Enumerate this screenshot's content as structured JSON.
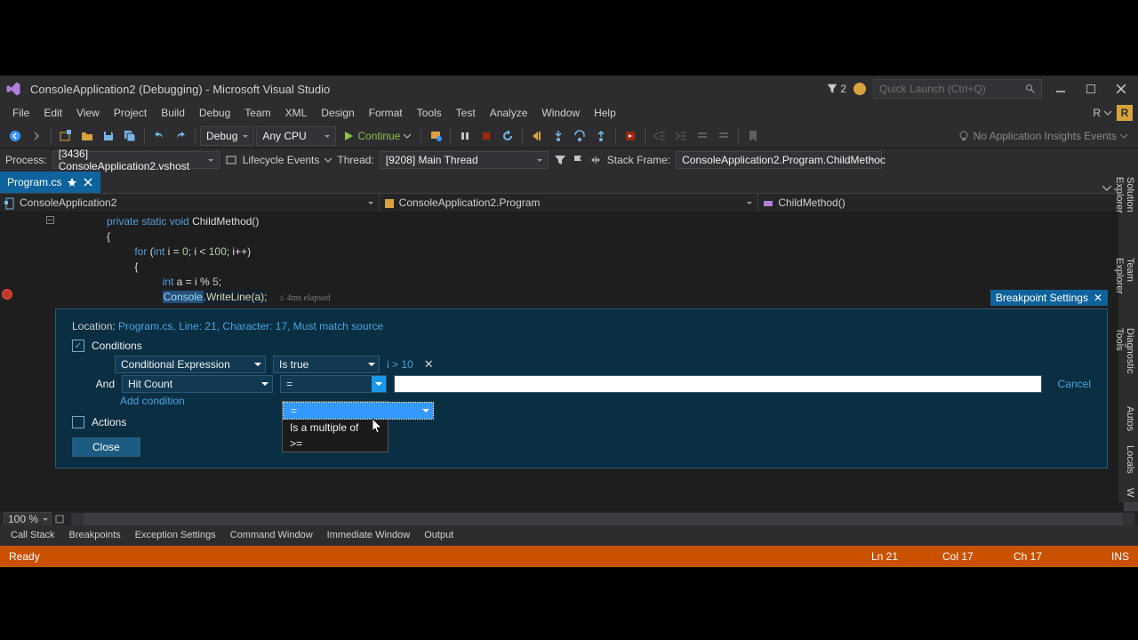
{
  "titlebar": {
    "title": "ConsoleApplication2 (Debugging) - Microsoft Visual Studio",
    "notif_count": "2",
    "quick_launch_placeholder": "Quick Launch (Ctrl+Q)"
  },
  "menu": [
    "File",
    "Edit",
    "View",
    "Project",
    "Build",
    "Debug",
    "Team",
    "XML",
    "Design",
    "Format",
    "Tools",
    "Test",
    "Analyze",
    "Window",
    "Help"
  ],
  "menu_right_letter": "R",
  "menu_right_badge": "R",
  "toolbar": {
    "config": "Debug",
    "platform": "Any CPU",
    "continue": "Continue",
    "insights": "No Application Insights Events"
  },
  "toolbar2": {
    "process_label": "Process:",
    "process_value": "[3436] ConsoleApplication2.vshost",
    "lifecycle": "Lifecycle Events",
    "thread_label": "Thread:",
    "thread_value": "[9208] Main Thread",
    "stackframe_label": "Stack Frame:",
    "stackframe_value": "ConsoleApplication2.Program.ChildMethoc"
  },
  "doctab": {
    "name": "Program.cs"
  },
  "navdrop": {
    "ns": "ConsoleApplication2",
    "class": "ConsoleApplication2.Program",
    "member": "ChildMethod()"
  },
  "code": {
    "l1a": "private ",
    "l1b": "static ",
    "l1c": "void ",
    "l1d": "ChildMethod()",
    "l2": "{",
    "l3a": "for ",
    "l3b": "(",
    "l3c": "int ",
    "l3d": "i = ",
    "l3e": "0",
    "l3f": "; i < ",
    "l3g": "100",
    "l3h": "; i++)",
    "l4": "{",
    "l5a": "int ",
    "l5b": "a = i % ",
    "l5c": "5",
    "l5d": ";",
    "l6a": "Console",
    "l6b": ".",
    "l6c": "WriteLine(a);",
    "elapsed": "≤ 4ms elapsed"
  },
  "bp_settings": {
    "title": "Breakpoint Settings",
    "location_label": "Location:",
    "location_value": "Program.cs, Line: 21, Character: 17, Must match source",
    "conditions": "Conditions",
    "cond_expr": "Conditional Expression",
    "is_true": "Is true",
    "expr_value": "i > 10",
    "and": "And",
    "hitcount": "Hit Count",
    "op": "=",
    "cancel": "Cancel",
    "add_condition": "Add condition",
    "actions": "Actions",
    "close": "Close",
    "dd_items": [
      "=",
      "Is a multiple of",
      ">="
    ]
  },
  "rightrail": [
    "Solution Explorer",
    "Team Explorer",
    "Diagnostic Tools",
    "Autos",
    "Locals",
    "W"
  ],
  "zoom": "100 %",
  "bottom_tabs": [
    "Call Stack",
    "Breakpoints",
    "Exception Settings",
    "Command Window",
    "Immediate Window",
    "Output"
  ],
  "status": {
    "ready": "Ready",
    "ln": "Ln 21",
    "col": "Col 17",
    "ch": "Ch 17",
    "ins": "INS"
  }
}
